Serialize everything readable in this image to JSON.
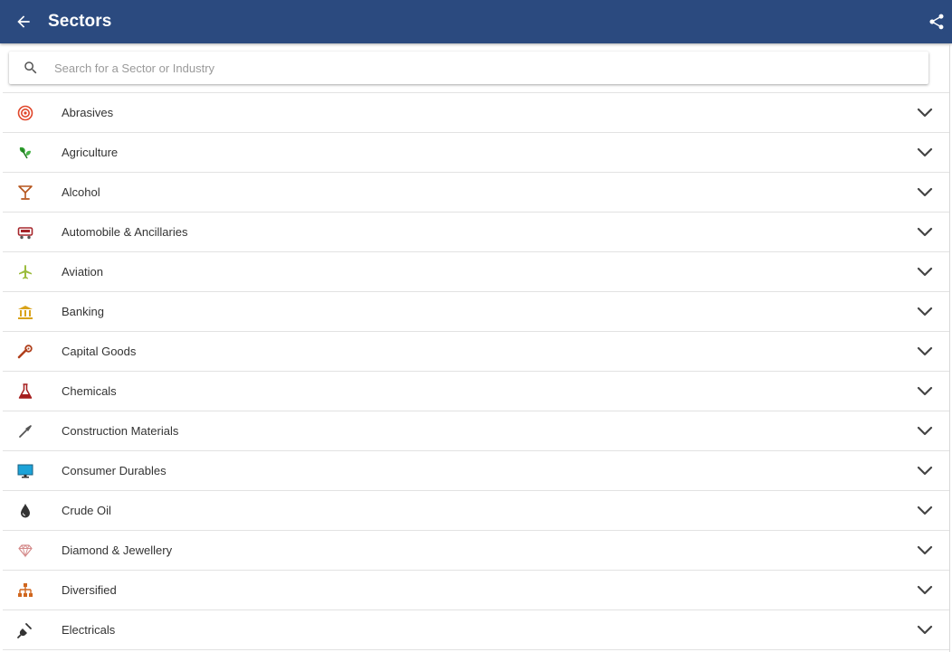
{
  "appbar": {
    "title": "Sectors",
    "bg_color": "#2b4a7f",
    "back_icon": "arrow-left-icon",
    "share_icon": "share-icon"
  },
  "search": {
    "placeholder": "Search for a Sector or Industry",
    "value": "",
    "icon": "search-icon"
  },
  "sectors": [
    {
      "label": "Abrasives",
      "icon": "abrasives-icon",
      "color": "#e0462a"
    },
    {
      "label": "Agriculture",
      "icon": "agriculture-icon",
      "color": "#2e9e2e"
    },
    {
      "label": "Alcohol",
      "icon": "alcohol-icon",
      "color": "#b5541b"
    },
    {
      "label": "Automobile & Ancillaries",
      "icon": "automobile-icon",
      "color": "#a6262b"
    },
    {
      "label": "Aviation",
      "icon": "aviation-icon",
      "color": "#9bbc3c"
    },
    {
      "label": "Banking",
      "icon": "banking-icon",
      "color": "#d9a31a"
    },
    {
      "label": "Capital Goods",
      "icon": "capital-goods-icon",
      "color": "#b0401c"
    },
    {
      "label": "Chemicals",
      "icon": "chemicals-icon",
      "color": "#a51d1d"
    },
    {
      "label": "Construction Materials",
      "icon": "construction-materials-icon",
      "color": "#555555"
    },
    {
      "label": "Consumer Durables",
      "icon": "consumer-durables-icon",
      "color": "#1ca3d8"
    },
    {
      "label": "Crude Oil",
      "icon": "crude-oil-icon",
      "color": "#333333"
    },
    {
      "label": "Diamond & Jewellery",
      "icon": "diamond-icon",
      "color": "#d48a8a"
    },
    {
      "label": "Diversified",
      "icon": "diversified-icon",
      "color": "#d0661e"
    },
    {
      "label": "Electricals",
      "icon": "electricals-icon",
      "color": "#333333"
    }
  ]
}
